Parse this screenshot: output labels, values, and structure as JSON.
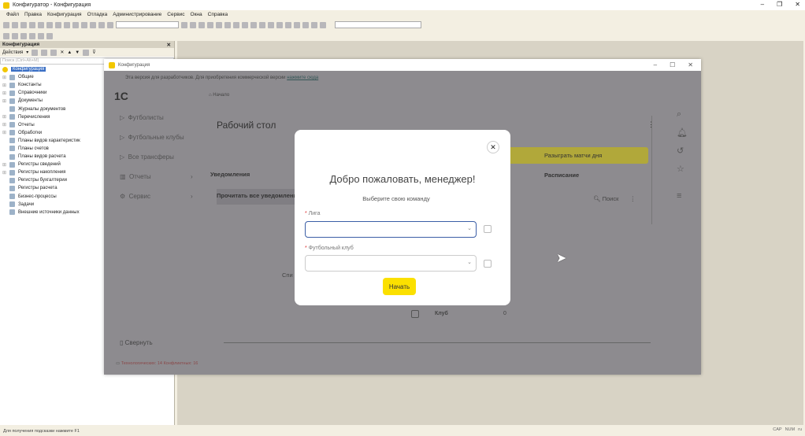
{
  "app": {
    "title": "Конфигуратор - Конфигурация"
  },
  "menu": [
    "Файл",
    "Правка",
    "Конфигурация",
    "Отладка",
    "Администрирование",
    "Сервис",
    "Окна",
    "Справка"
  ],
  "left_panel": {
    "title": "Конфигурация",
    "actions_label": "Действия",
    "search_placeholder": "Поиск (Ctrl+Alt+M)",
    "root": "Конфигурация",
    "items": [
      {
        "label": "Общие",
        "exp": true
      },
      {
        "label": "Константы",
        "exp": true
      },
      {
        "label": "Справочники",
        "exp": true
      },
      {
        "label": "Документы",
        "exp": true
      },
      {
        "label": "Журналы документов",
        "exp": false
      },
      {
        "label": "Перечисления",
        "exp": true
      },
      {
        "label": "Отчеты",
        "exp": true
      },
      {
        "label": "Обработки",
        "exp": true
      },
      {
        "label": "Планы видов характеристик",
        "exp": false
      },
      {
        "label": "Планы счетов",
        "exp": false
      },
      {
        "label": "Планы видов расчета",
        "exp": false
      },
      {
        "label": "Регистры сведений",
        "exp": true
      },
      {
        "label": "Регистры накопления",
        "exp": true
      },
      {
        "label": "Регистры бухгалтерии",
        "exp": false
      },
      {
        "label": "Регистры расчета",
        "exp": false
      },
      {
        "label": "Бизнес-процессы",
        "exp": false
      },
      {
        "label": "Задачи",
        "exp": false
      },
      {
        "label": "Внешние источники данных",
        "exp": false
      }
    ]
  },
  "inner": {
    "title": "Конфигурация",
    "banner": "Эта версия для разработчиков. Для приобретения коммерческой версии ",
    "banner_link": "нажмите сюда",
    "breadcrumb": "Начало",
    "nav": [
      "Футболисты",
      "Футбольные клубы",
      "Все трансферы",
      "Отчеты",
      "Сервис"
    ],
    "collapse": "Свернуть",
    "page_title": "Рабочий стол",
    "notifications": "Уведомления",
    "read_all": "Прочитать все уведомления",
    "play_button": "Разыграть матчи дня",
    "schedule": "Расписание",
    "search": "Поиск",
    "list_label": "Спи",
    "club_col": "Клуб",
    "club_val": "0",
    "status": "Технологических: 14   Конфликтных: 16"
  },
  "modal": {
    "title": "Добро пожаловать, менеджер!",
    "subtitle": "Выберите свою команду",
    "league_label": "Лига",
    "club_label": "Футбольный клуб",
    "league_value": "",
    "club_value": "",
    "start": "Начать"
  },
  "statusbar": {
    "hint": "Для получения подсказки нажмите F1",
    "cap": "CAP",
    "num": "NUM",
    "lang": "ru"
  }
}
